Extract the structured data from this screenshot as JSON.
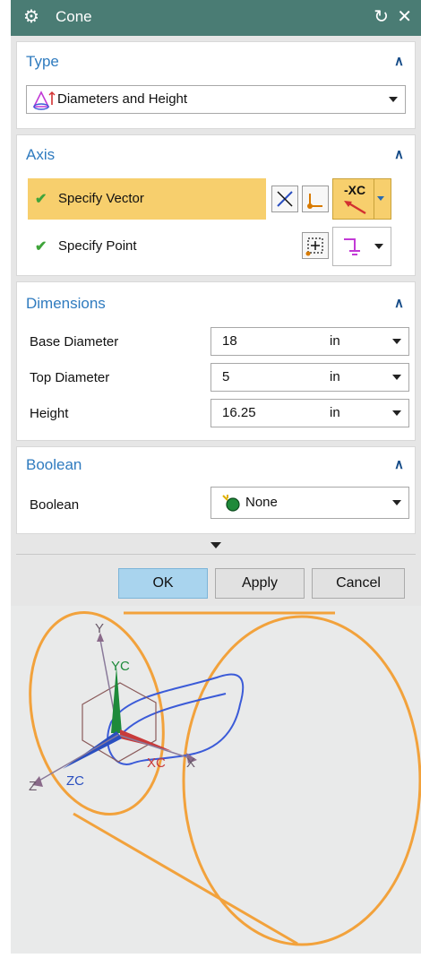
{
  "dialog": {
    "title": "Cone"
  },
  "type": {
    "header": "Type",
    "value": "Diameters and Height"
  },
  "axis": {
    "header": "Axis",
    "specify_vector": "Specify Vector",
    "specify_point": "Specify Point",
    "vector_option": "-XC"
  },
  "dimensions": {
    "header": "Dimensions",
    "rows": [
      {
        "label": "Base Diameter",
        "value": "18",
        "unit": "in"
      },
      {
        "label": "Top Diameter",
        "value": "5",
        "unit": "in"
      },
      {
        "label": "Height",
        "value": "16.25",
        "unit": "in"
      }
    ]
  },
  "boolean": {
    "header": "Boolean",
    "label": "Boolean",
    "value": "None"
  },
  "buttons": {
    "ok": "OK",
    "apply": "Apply",
    "cancel": "Cancel"
  },
  "viewport": {
    "axis_labels": {
      "y": "Y",
      "yc": "YC",
      "x": "X",
      "xc": "XC",
      "z": "Z",
      "zc": "ZC"
    },
    "colors": {
      "cone": "#f2a23c",
      "curve": "#3b5bd8",
      "yc": "#1d8a3a",
      "xc": "#c83a3a",
      "zc": "#2a4fc0"
    }
  }
}
